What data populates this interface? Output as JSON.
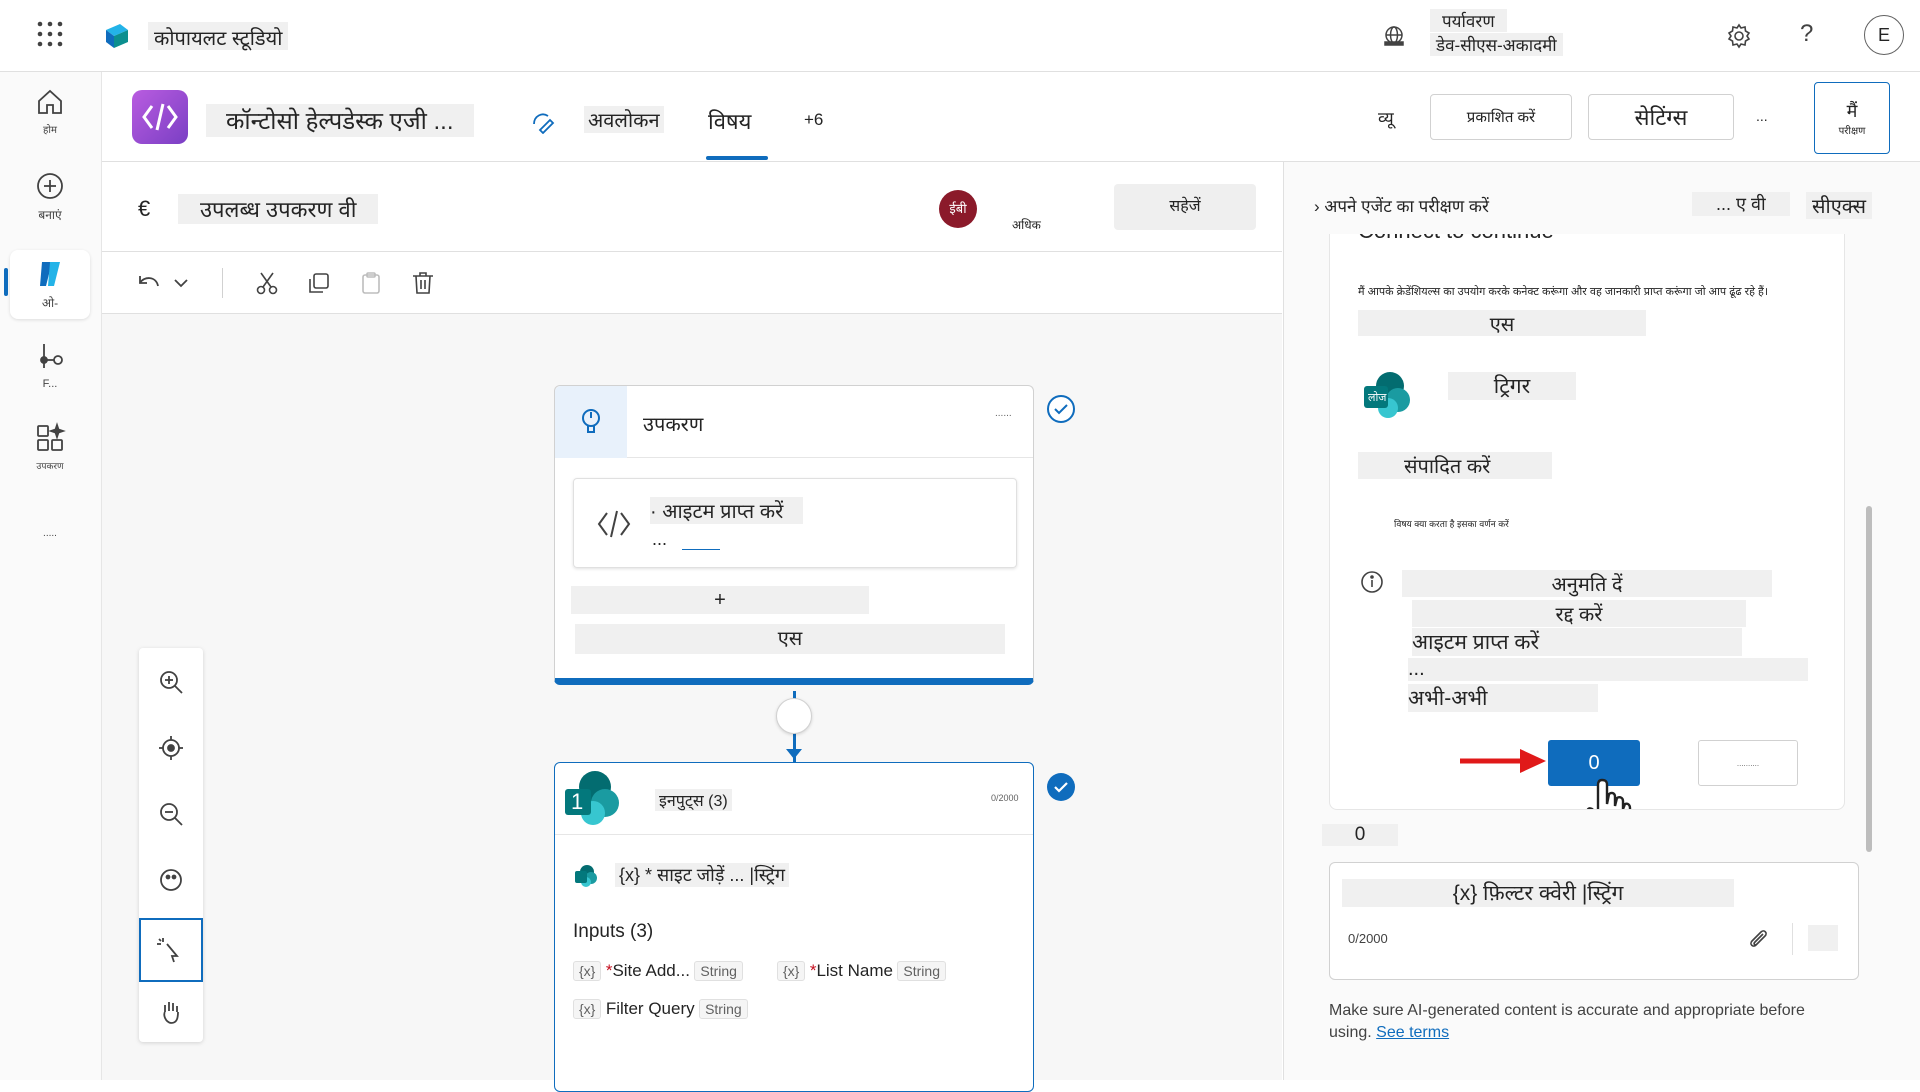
{
  "app": {
    "name": "कोपायलट स्टूडियो",
    "environment_label": "पर्यावरण",
    "environment_name": "डेव-सीएस-अकादमी",
    "help": "?",
    "user_initial": "E"
  },
  "rail": {
    "home": "होम",
    "create": "बनाएं",
    "agents": "ओ-",
    "flows": "F...",
    "tools": "उपकरण",
    "more": "....."
  },
  "agent": {
    "name": "कॉन्टोसो हेल्पडेस्क एजी ...",
    "tabs": [
      "अवलोकन",
      "विषय",
      "+6"
    ],
    "active_tab": "विषय",
    "view_label": "व्यू",
    "publish": "प्रकाशित करें",
    "settings": "सेटिंग्स",
    "ellipsis": "...",
    "test_top": "मैं",
    "test_bottom": "परीक्षण"
  },
  "topic": {
    "back_symbol": "€",
    "title": "उपलब्ध उपकरण वी",
    "avatar": "ईबी",
    "more": "अधिक",
    "save": "सहेजें"
  },
  "canvas": {
    "tool_node_title": "उपकरण",
    "tool_node_menu": "......",
    "action_title": "· आइटम प्राप्त करें",
    "action_sub": "...",
    "add": "+",
    "footer": "एस",
    "sp_badge": "1",
    "inputs_header": "इनपुट्स (3)",
    "counter": "0/2000",
    "input_line": "{x} * साइट जोड़ें ... |स्ट्रिंग",
    "inputs_label": "Inputs (3)",
    "inputs": [
      {
        "icon": "{x}",
        "name": "Site Add...",
        "type": "String",
        "required": true
      },
      {
        "icon": "{x}",
        "name": "List Name",
        "type": "String",
        "required": true
      },
      {
        "icon": "{x}",
        "name": "Filter Query",
        "type": "String",
        "required": false
      }
    ]
  },
  "test_panel": {
    "title": "› अपने एजेंट का परीक्षण करें",
    "header_a": "... ए वी",
    "header_b": "सीएक्स",
    "connect_title": "Connect to continue",
    "connect_desc": "मैं आपके क्रेडेंशियल्स का उपयोग करके कनेक्ट करूंगा और वह जानकारी प्राप्त करूंगा जो आप ढूंढ रहे हैं।",
    "line_s": "एस",
    "sp_icon_label": "लोज",
    "trigger": "ट्रिगर",
    "edit": "संपादित करें",
    "describe": "विषय क्या करता है इसका वर्णन करें",
    "allow": "अनुमति दें",
    "cancel": "रद्द करें",
    "get_items": "आइटम प्राप्त करें",
    "dots": "...",
    "just_now": "अभी-अभी",
    "allow_button": "0",
    "secondary_button": "..........",
    "count": "0",
    "input_text": "{x} फ़िल्टर क्वेरी |स्ट्रिंग",
    "input_counter": "0/2000",
    "disclaimer": "Make sure AI-generated content is accurate and appropriate before using.",
    "see_terms": "See terms"
  },
  "colors": {
    "accent": "#0f6cbd",
    "allow_button": "#0f6cbd",
    "check": "#0f6cbd",
    "arrow": "#e01919",
    "agent_icon": "#9b44d8"
  }
}
